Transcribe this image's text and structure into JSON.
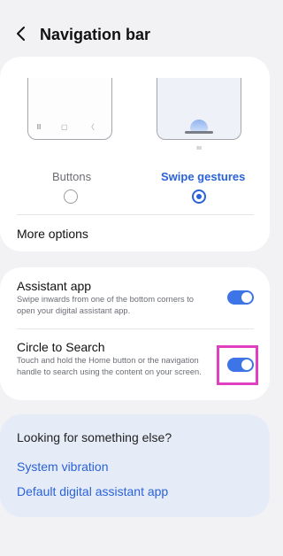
{
  "header": {
    "title": "Navigation bar",
    "back_icon": "chevron-left-icon"
  },
  "navigation_type": {
    "options": [
      {
        "label": "Buttons",
        "selected": false
      },
      {
        "label": "Swipe gestures",
        "selected": true
      }
    ],
    "preview_buttons_glyphs": "Ⅲ ▢ 〈",
    "preview_gesture_marks": "ııı"
  },
  "more_options": {
    "label": "More options"
  },
  "assistant_app": {
    "title": "Assistant app",
    "description": "Swipe inwards from one of the bottom corners to open your digital assistant app.",
    "enabled": true
  },
  "circle_to_search": {
    "title": "Circle to Search",
    "description": "Touch and hold the Home button or the navigation handle to search using the content on your screen.",
    "enabled": true
  },
  "suggestions": {
    "title": "Looking for something else?",
    "links": [
      "System vibration",
      "Default digital assistant app"
    ]
  },
  "colors": {
    "accent": "#2a62d8",
    "toggle_on": "#3d74e6",
    "highlight_box": "#e040c0",
    "background": "#f2f2f4"
  }
}
